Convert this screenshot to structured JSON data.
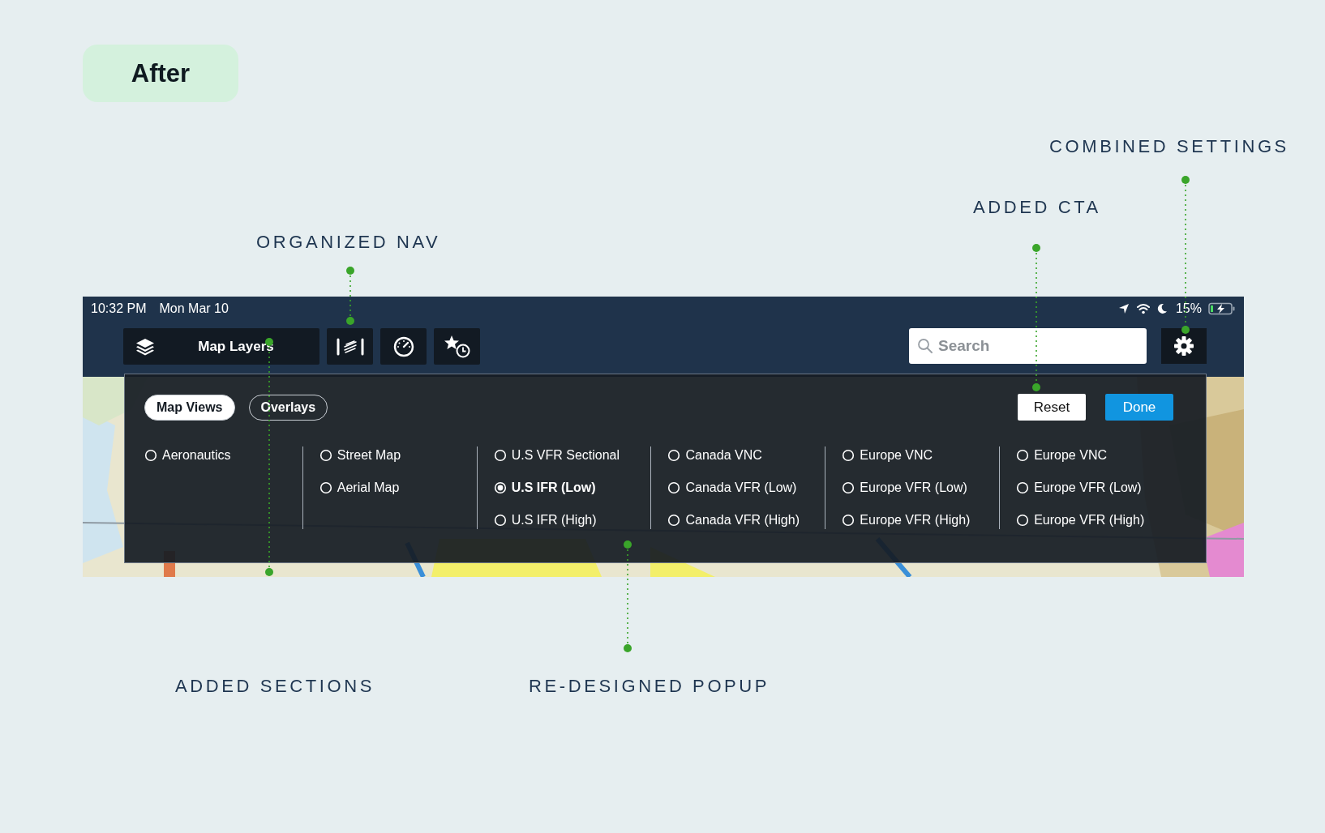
{
  "badge": "After",
  "annotations": [
    {
      "label": "COMBINED SETTINGS"
    },
    {
      "label": "ADDED CTA"
    },
    {
      "label": "ORGANIZED NAV"
    },
    {
      "label": "ADDED SECTIONS"
    },
    {
      "label": "RE-DESIGNED POPUP"
    }
  ],
  "status_bar": {
    "time": "10:32 PM",
    "date": "Mon Mar 10",
    "battery": "15%"
  },
  "toolbar": {
    "map_layers": "Map Layers",
    "search": {
      "placeholder": "Search"
    }
  },
  "popup": {
    "tabs": [
      {
        "label": "Map Views",
        "selected": true
      },
      {
        "label": "Overlays",
        "selected": false
      }
    ],
    "buttons": [
      {
        "label": "Reset",
        "kind": "secondary"
      },
      {
        "label": "Done",
        "kind": "primary"
      }
    ],
    "columns": [
      {
        "options": [
          {
            "label": "Aeronautics",
            "selected": false
          }
        ]
      },
      {
        "options": [
          {
            "label": "Street Map",
            "selected": false
          },
          {
            "label": "Aerial Map",
            "selected": false
          }
        ]
      },
      {
        "options": [
          {
            "label": "U.S VFR Sectional",
            "selected": false
          },
          {
            "label": "U.S IFR (Low)",
            "selected": true
          },
          {
            "label": "U.S IFR (High)",
            "selected": false
          }
        ]
      },
      {
        "options": [
          {
            "label": "Canada VNC",
            "selected": false
          },
          {
            "label": "Canada VFR (Low)",
            "selected": false
          },
          {
            "label": "Canada VFR (High)",
            "selected": false
          }
        ]
      },
      {
        "options": [
          {
            "label": "Europe VNC",
            "selected": false
          },
          {
            "label": "Europe VFR (Low)",
            "selected": false
          },
          {
            "label": "Europe VFR (High)",
            "selected": false
          }
        ]
      },
      {
        "options": [
          {
            "label": "Europe VNC",
            "selected": false
          },
          {
            "label": "Europe VFR (Low)",
            "selected": false
          },
          {
            "label": "Europe VFR (High)",
            "selected": false
          }
        ]
      }
    ]
  }
}
